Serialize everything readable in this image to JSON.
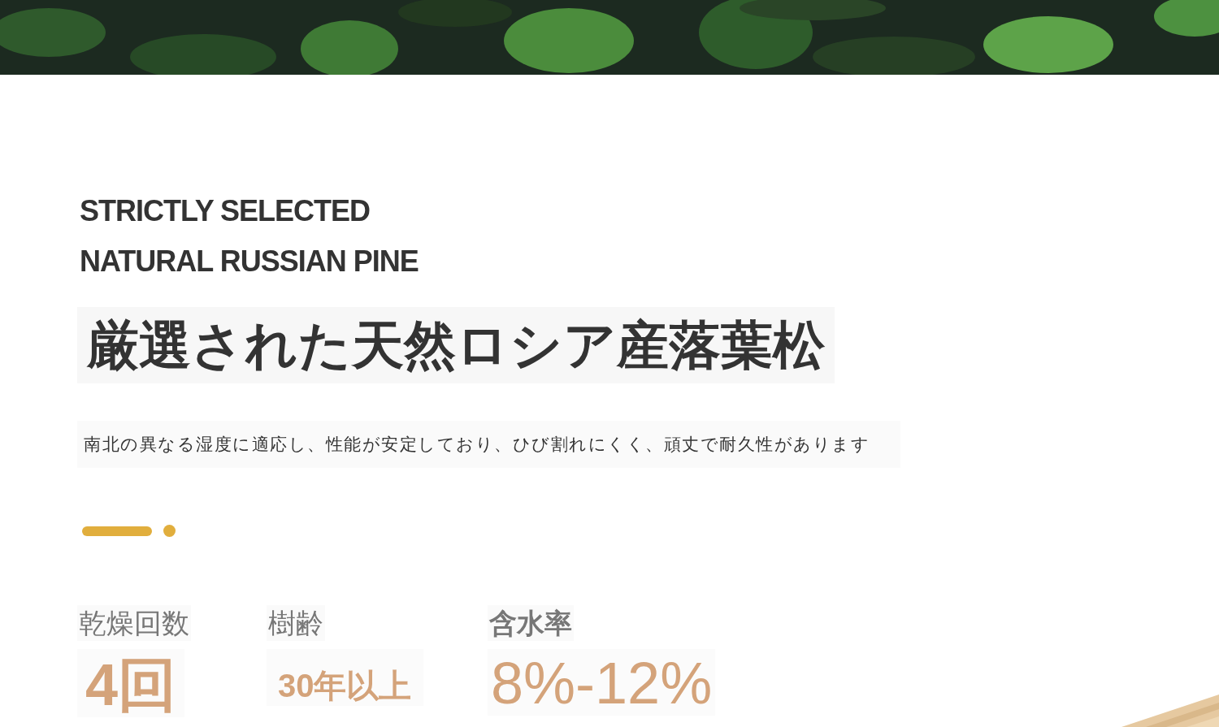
{
  "headline": [
    "STRICTLY SELECTED",
    "NATURAL RUSSIAN PINE"
  ],
  "title": "厳選された天然ロシア産落葉松",
  "subtitle": "南北の異なる湿度に適応し、性能が安定しており、ひび割れにくく、頑丈で耐久性があります",
  "stats": [
    {
      "label": "乾燥回数",
      "value": "4回",
      "kind": "large"
    },
    {
      "label": "樹齢",
      "value": "30年以上",
      "kind": "small"
    },
    {
      "label": "含水率",
      "value": "8%-12%",
      "kind": "light"
    }
  ]
}
